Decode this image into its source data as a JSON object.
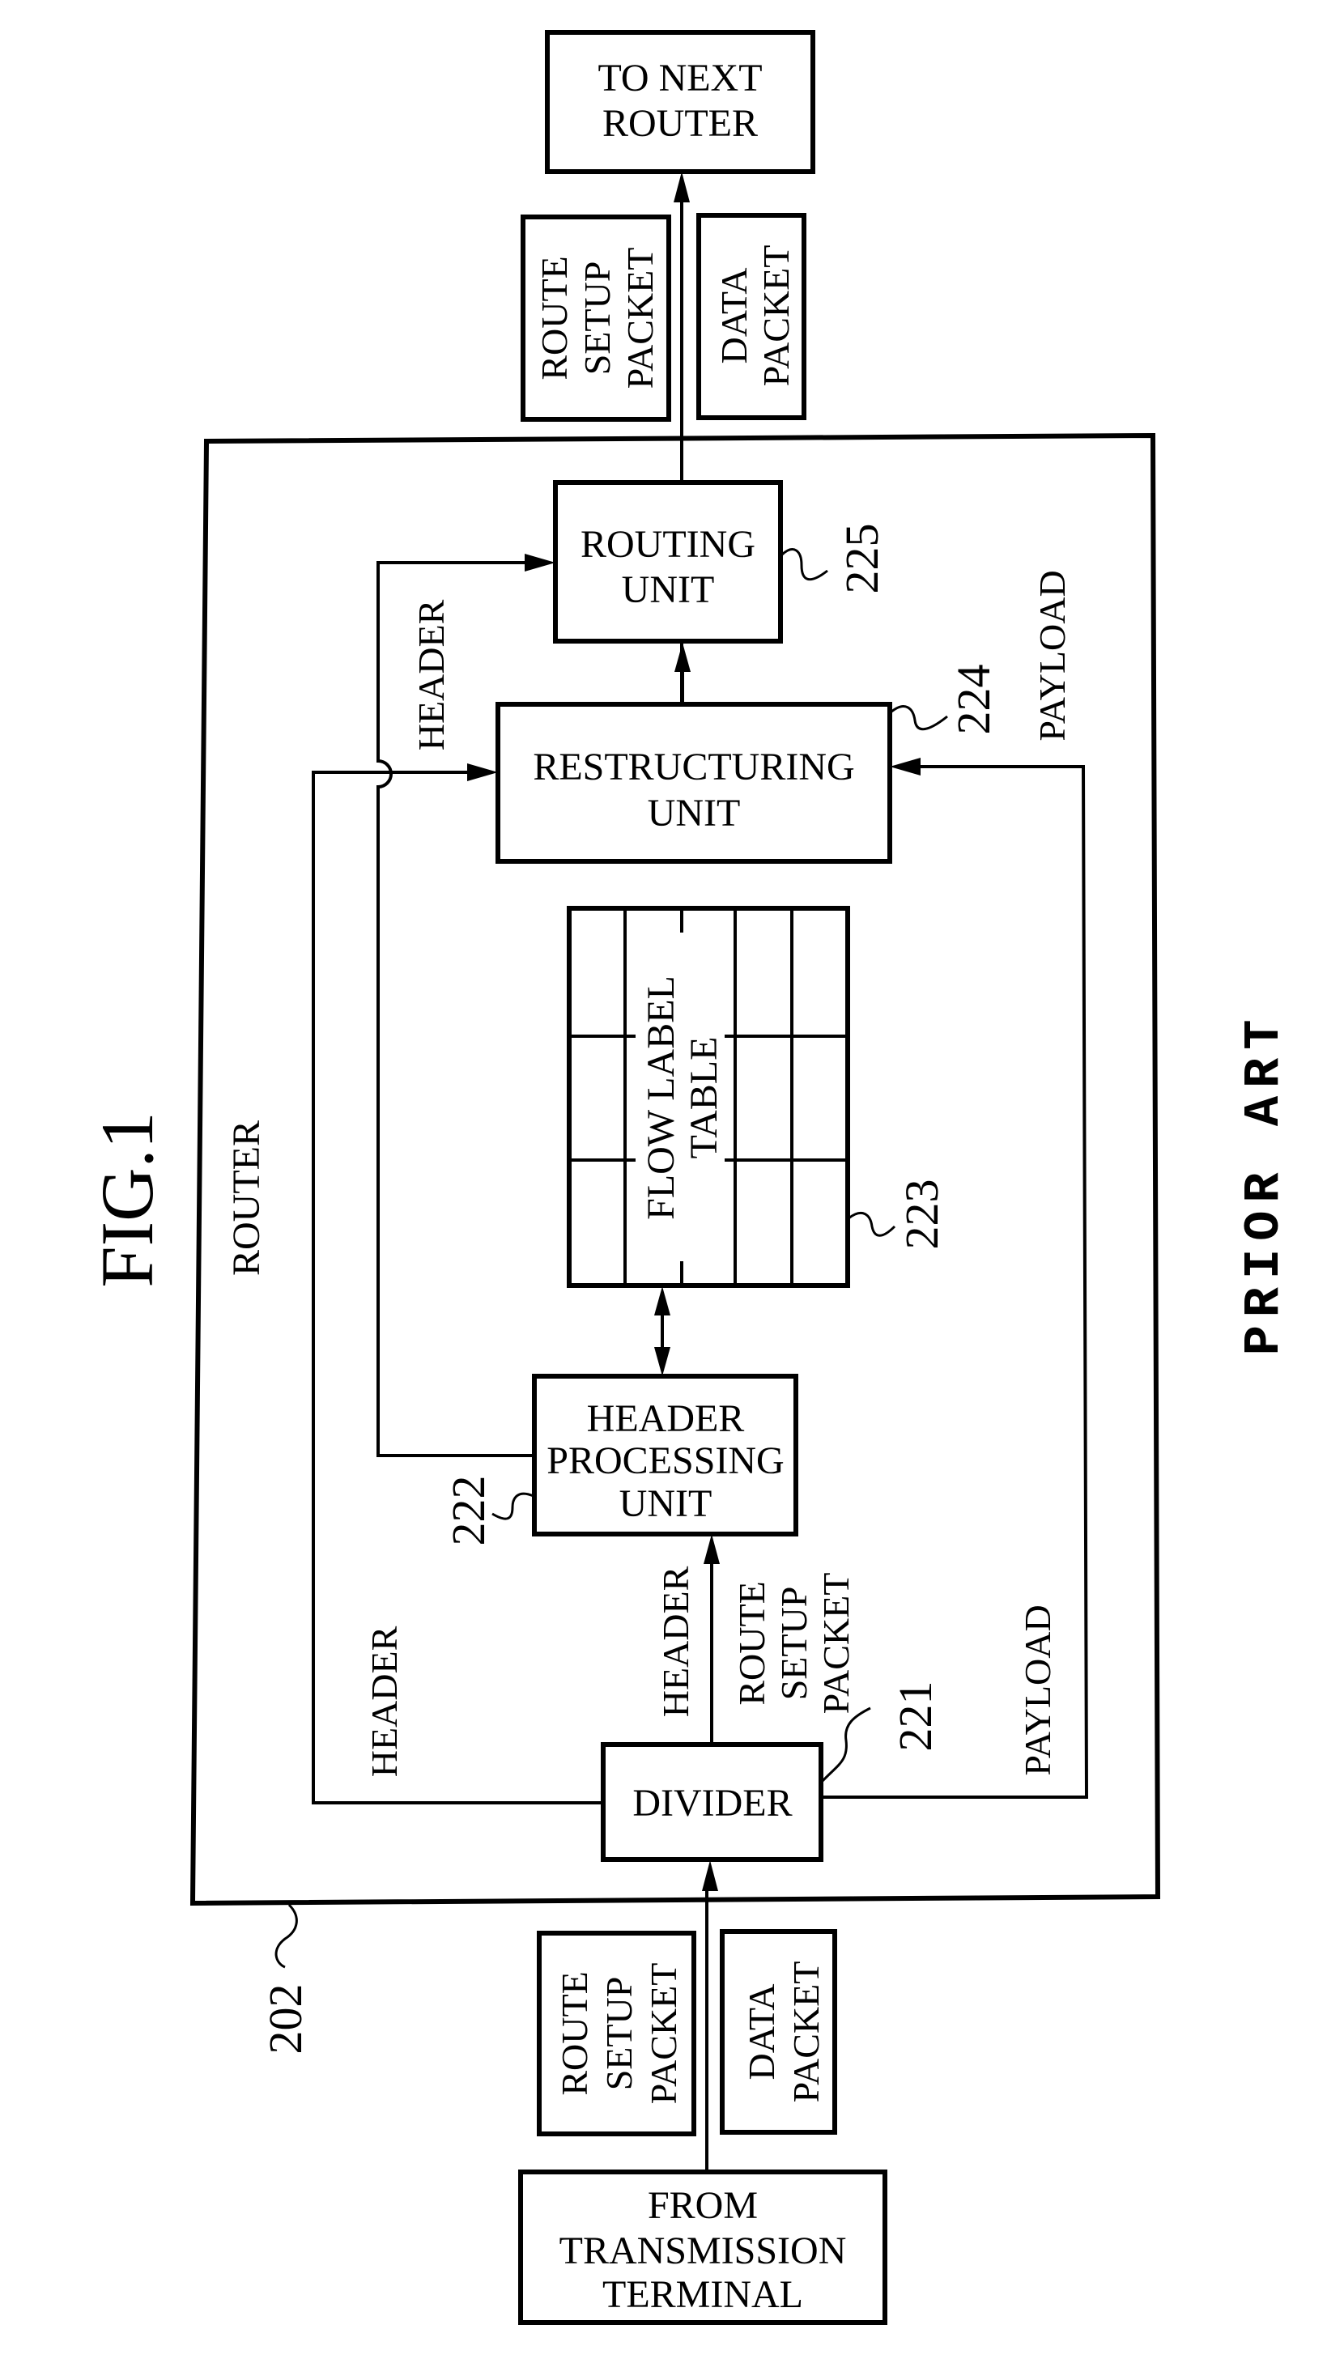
{
  "figure": {
    "title": "FIG.1",
    "caption": "PRIOR ART",
    "container_label": "ROUTER",
    "container_ref": "202"
  },
  "terminals": {
    "destination": [
      "TO NEXT",
      "ROUTER"
    ],
    "source": [
      "FROM",
      "TRANSMISSION",
      "TERMINAL"
    ]
  },
  "packets_out": {
    "route_setup": [
      "ROUTE",
      "SETUP",
      "PACKET"
    ],
    "data": [
      "DATA",
      "PACKET"
    ]
  },
  "packets_in": {
    "route_setup": [
      "ROUTE",
      "SETUP",
      "PACKET"
    ],
    "data": [
      "DATA",
      "PACKET"
    ]
  },
  "units": {
    "divider": {
      "label": [
        "DIVIDER"
      ],
      "ref": "221"
    },
    "header_processing": {
      "label": [
        "HEADER",
        "PROCESSING",
        "UNIT"
      ],
      "ref": "222"
    },
    "flow_label_table": {
      "label": [
        "FLOW LABEL",
        "TABLE"
      ],
      "ref": "223",
      "rows": 3,
      "columns": 5
    },
    "restructuring": {
      "label": [
        "RESTRUCTURING",
        "UNIT"
      ],
      "ref": "224"
    },
    "routing": {
      "label": [
        "ROUTING",
        "UNIT"
      ],
      "ref": "225"
    }
  },
  "flow_labels": {
    "header_to_routing": "HEADER",
    "header_to_restructuring": "HEADER",
    "divider_to_hpu_header": "HEADER",
    "divider_to_hpu_packet": [
      "ROUTE",
      "SETUP",
      "PACKET"
    ],
    "payload_upper": "PAYLOAD",
    "payload_lower": "PAYLOAD"
  }
}
